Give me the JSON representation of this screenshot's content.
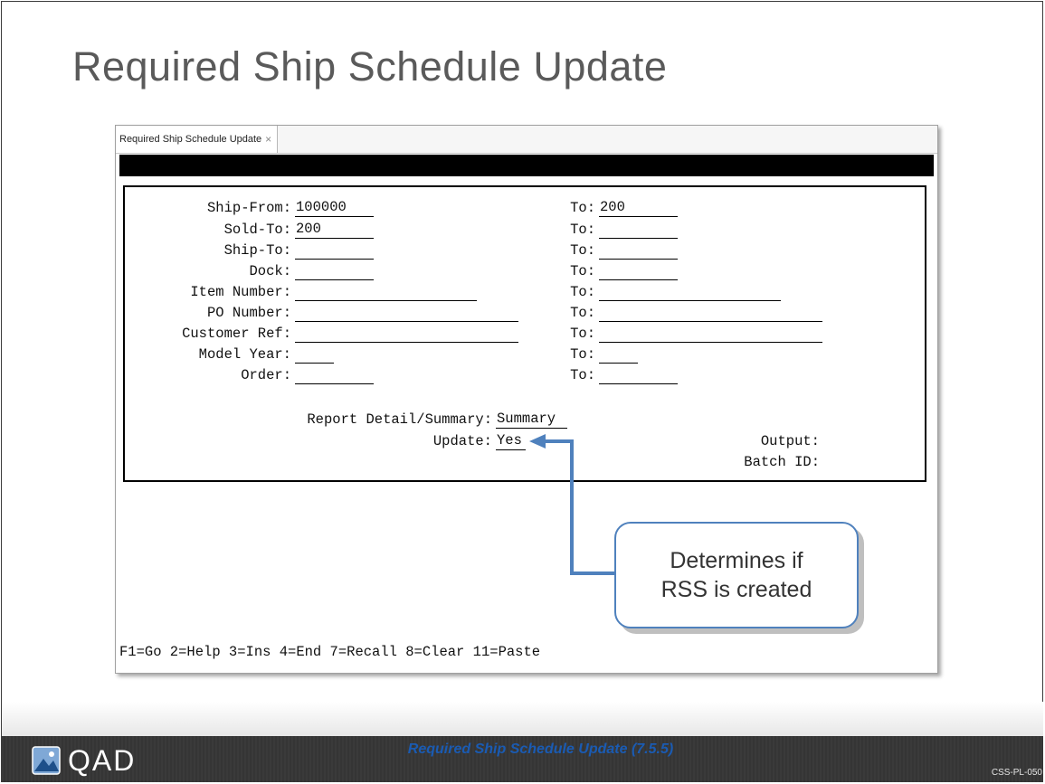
{
  "slide": {
    "title": "Required Ship Schedule Update"
  },
  "window": {
    "tab_label": "Required Ship Schedule Update",
    "tab_close_glyph": "×"
  },
  "form": {
    "fields": [
      {
        "label": "Ship-From:",
        "value": "100000",
        "to_label": "To:",
        "to_value": "200"
      },
      {
        "label": "Sold-To:",
        "value": "200",
        "to_label": "To:",
        "to_value": ""
      },
      {
        "label": "Ship-To:",
        "value": "",
        "to_label": "To:",
        "to_value": ""
      },
      {
        "label": "Dock:",
        "value": "",
        "to_label": "To:",
        "to_value": ""
      },
      {
        "label": "Item Number:",
        "value": "",
        "to_label": "To:",
        "to_value": ""
      },
      {
        "label": "PO Number:",
        "value": "",
        "to_label": "To:",
        "to_value": ""
      },
      {
        "label": "Customer Ref:",
        "value": "",
        "to_label": "To:",
        "to_value": ""
      },
      {
        "label": "Model Year:",
        "value": "",
        "to_label": "To:",
        "to_value": ""
      },
      {
        "label": "Order:",
        "value": "",
        "to_label": "To:",
        "to_value": ""
      }
    ],
    "report_label": "Report Detail/Summary:",
    "report_value": "Summary",
    "update_label": "Update:",
    "update_value": "Yes",
    "output_label": "Output:",
    "batch_label": "Batch ID:"
  },
  "function_keys": "F1=Go 2=Help 3=Ins 4=End 7=Recall 8=Clear 11=Paste",
  "callout": {
    "line1": "Determines if",
    "line2": "RSS is created"
  },
  "footer": {
    "logo_text": "QAD",
    "caption": "Required Ship Schedule Update (7.5.5)",
    "code": "CSS-PL-050"
  },
  "colors": {
    "title": "#5a5a5a",
    "callout_border": "#4f81bd",
    "arrow": "#4f81bd",
    "footer_caption": "#1a5bb3"
  }
}
